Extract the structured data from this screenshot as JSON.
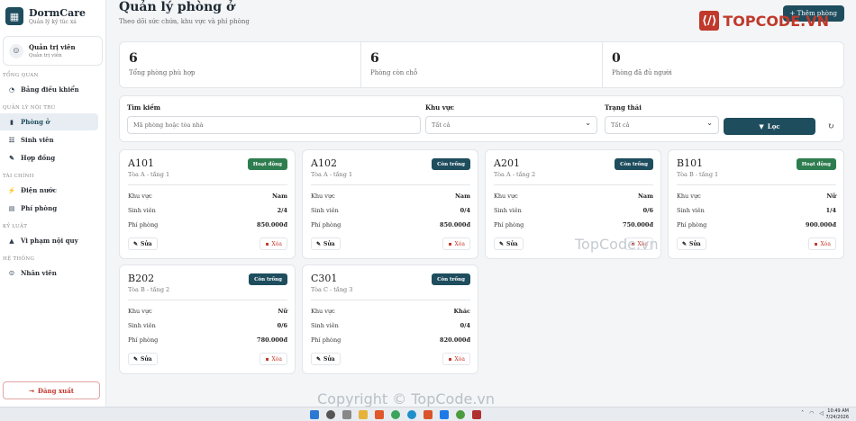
{
  "brand": {
    "name": "DormCare",
    "sub": "Quản lý ký túc xá"
  },
  "user": {
    "name": "Quản trị viên",
    "role": "Quản trị viên"
  },
  "nav": {
    "sections": [
      {
        "label": "TỔNG QUAN",
        "items": [
          {
            "label": "Bảng điều khiển",
            "icon": "dashboard-icon",
            "glyph": "◔"
          }
        ]
      },
      {
        "label": "QUẢN LÝ NỘI TRÚ",
        "items": [
          {
            "label": "Phòng ở",
            "icon": "door-icon",
            "glyph": "▮",
            "active": true
          },
          {
            "label": "Sinh viên",
            "icon": "students-icon",
            "glyph": "☷"
          },
          {
            "label": "Hợp đồng",
            "icon": "contract-icon",
            "glyph": "✎"
          }
        ]
      },
      {
        "label": "TÀI CHÍNH",
        "items": [
          {
            "label": "Điện nước",
            "icon": "bolt-icon",
            "glyph": "⚡"
          },
          {
            "label": "Phí phòng",
            "icon": "bill-icon",
            "glyph": "▤"
          }
        ]
      },
      {
        "label": "KỶ LUẬT",
        "items": [
          {
            "label": "Vi phạm nội quy",
            "icon": "warning-icon",
            "glyph": "▲"
          }
        ]
      },
      {
        "label": "HỆ THỐNG",
        "items": [
          {
            "label": "Nhân viên",
            "icon": "staff-icon",
            "glyph": "☺"
          }
        ]
      }
    ],
    "logout": "Đăng xuất"
  },
  "header": {
    "title": "Quản lý phòng ở",
    "subtitle": "Theo dõi sức chứa, khu vực và phí phòng",
    "add_label": "+ Thêm phòng"
  },
  "watermark": {
    "logo": "TOPCODE.VN",
    "mid": "TopCode.vn",
    "copyright": "Copyright © TopCode.vn"
  },
  "stats": [
    {
      "value": "6",
      "label": "Tổng phòng phù hợp"
    },
    {
      "value": "6",
      "label": "Phòng còn chỗ"
    },
    {
      "value": "0",
      "label": "Phòng đã đủ người"
    }
  ],
  "filters": {
    "search_label": "Tìm kiếm",
    "search_placeholder": "Mã phòng hoặc tòa nhà",
    "area_label": "Khu vực",
    "area_value": "Tất cả",
    "status_label": "Trạng thái",
    "status_value": "Tất cả",
    "filter_button": "Lọc"
  },
  "labels": {
    "area": "Khu vực",
    "students": "Sinh viên",
    "fee": "Phí phòng",
    "edit": "Sửa",
    "delete": "Xóa"
  },
  "rooms": [
    {
      "name": "A101",
      "location": "Tòa A - tầng 1",
      "status": "Hoạt động",
      "active": true,
      "area": "Nam",
      "students": "2/4",
      "fee": "850.000đ"
    },
    {
      "name": "A102",
      "location": "Tòa A - tầng 1",
      "status": "Còn trống",
      "active": false,
      "area": "Nam",
      "students": "0/4",
      "fee": "850.000đ"
    },
    {
      "name": "A201",
      "location": "Tòa A - tầng 2",
      "status": "Còn trống",
      "active": false,
      "area": "Nam",
      "students": "0/6",
      "fee": "750.000đ"
    },
    {
      "name": "B101",
      "location": "Tòa B - tầng 1",
      "status": "Hoạt động",
      "active": true,
      "area": "Nữ",
      "students": "1/4",
      "fee": "900.000đ"
    },
    {
      "name": "B202",
      "location": "Tòa B - tầng 2",
      "status": "Còn trống",
      "active": false,
      "area": "Nữ",
      "students": "0/6",
      "fee": "780.000đ"
    },
    {
      "name": "C301",
      "location": "Tòa C - tầng 3",
      "status": "Còn trống",
      "active": false,
      "area": "Khác",
      "students": "0/4",
      "fee": "820.000đ"
    }
  ],
  "taskbar": {
    "time": "10:49 AM",
    "date": "7/24/2026"
  }
}
